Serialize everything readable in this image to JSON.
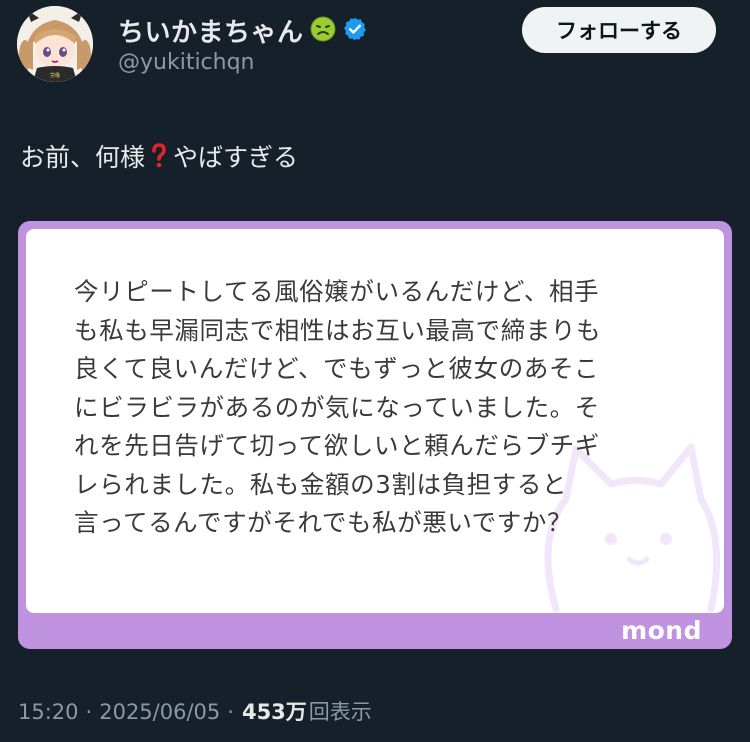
{
  "user": {
    "display_name": "ちいかまちゃん",
    "handle": "@yukitichqn",
    "emoji_icon": "nauseated-face-emoji",
    "verified_icon": "verified-badge-icon",
    "shirt_text": "労働\nキャンセル"
  },
  "follow_button": {
    "label": "フォローする"
  },
  "tweet": {
    "text_before": "お前、何様",
    "text_after": "やばすぎる",
    "emoji_icon": "red-question-mark-emoji"
  },
  "card": {
    "text": "今リピートしてる風俗嬢がいるんだけど、相手\nも私も早漏同志で相性はお互い最高で締まりも\n良くて良いんだけど、でもずっと彼女のあそこ\nにビラビラがあるのが気になっていました。そ\nれを先日告げて切って欲しいと頼んだらブチギ\nレられました。私も金額の3割は負担すると\n言ってるんですがそれでも私が悪いですか？",
    "watermark": "mond"
  },
  "meta": {
    "time": "15:20",
    "sep1": "·",
    "date": "2025/06/05",
    "sep2": "·",
    "views": "453万",
    "views_label": "回表示"
  },
  "colors": {
    "background": "#15202b",
    "card_border": "#bf93e0",
    "verified": "#1d9bf0",
    "follow_bg": "#eff3f4"
  }
}
